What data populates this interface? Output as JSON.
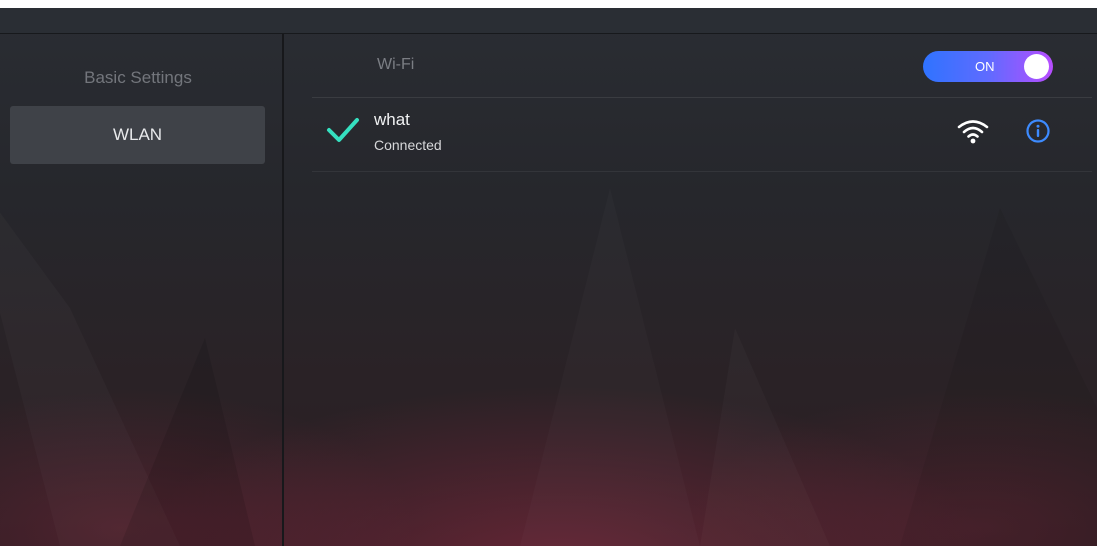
{
  "sidebar": {
    "heading": "Basic Settings",
    "items": [
      {
        "label": "WLAN",
        "selected": true
      }
    ]
  },
  "wifi": {
    "label": "Wi-Fi",
    "toggle_label": "ON",
    "enabled": true
  },
  "networks": [
    {
      "name": "what",
      "status": "Connected",
      "icons": [
        "check-icon",
        "wifi-signal-icon",
        "info-icon"
      ]
    }
  ],
  "colors": {
    "toggle_start": "#2f73ff",
    "toggle_end": "#b84dff",
    "check": "#35e0c0",
    "info": "#3d8bff"
  }
}
